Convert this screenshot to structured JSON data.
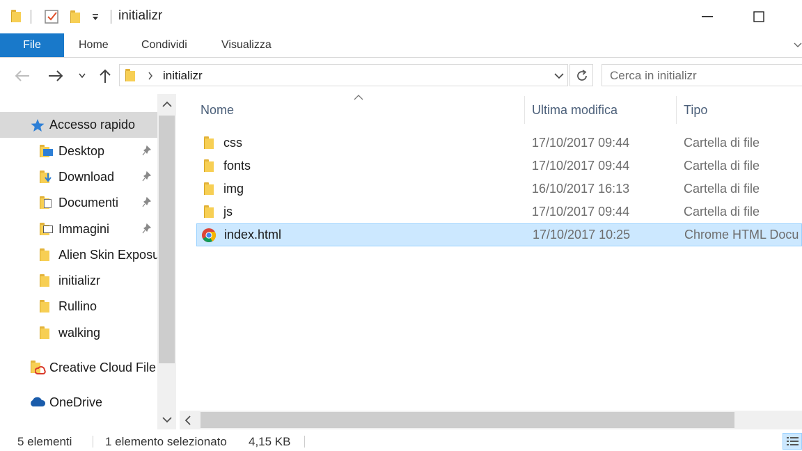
{
  "window": {
    "title": "initializr"
  },
  "ribbon": {
    "tabs": [
      "File",
      "Home",
      "Condividi",
      "Visualizza"
    ]
  },
  "address": {
    "path_item": "initializr",
    "search_placeholder": "Cerca in initializr"
  },
  "nav": {
    "quick_access": "Accesso rapido",
    "items": [
      {
        "label": "Desktop",
        "icon": "desktop-folder-icon",
        "pinned": true
      },
      {
        "label": "Download",
        "icon": "download-folder-icon",
        "pinned": true
      },
      {
        "label": "Documenti",
        "icon": "documents-folder-icon",
        "pinned": true
      },
      {
        "label": "Immagini",
        "icon": "pictures-folder-icon",
        "pinned": true
      },
      {
        "label": "Alien Skin Exposu",
        "icon": "folder-icon",
        "pinned": false
      },
      {
        "label": "initializr",
        "icon": "folder-icon",
        "pinned": false
      },
      {
        "label": "Rullino",
        "icon": "folder-icon",
        "pinned": false
      },
      {
        "label": "walking",
        "icon": "folder-icon",
        "pinned": false
      }
    ],
    "creative_cloud": "Creative Cloud File",
    "onedrive": "OneDrive"
  },
  "columns": {
    "name": "Nome",
    "modified": "Ultima modifica",
    "type": "Tipo"
  },
  "files": [
    {
      "name": "css",
      "modified": "17/10/2017 09:44",
      "type": "Cartella di file",
      "icon": "folder-icon",
      "selected": false
    },
    {
      "name": "fonts",
      "modified": "17/10/2017 09:44",
      "type": "Cartella di file",
      "icon": "folder-icon",
      "selected": false
    },
    {
      "name": "img",
      "modified": "16/10/2017 16:13",
      "type": "Cartella di file",
      "icon": "folder-icon",
      "selected": false
    },
    {
      "name": "js",
      "modified": "17/10/2017 09:44",
      "type": "Cartella di file",
      "icon": "folder-icon",
      "selected": false
    },
    {
      "name": "index.html",
      "modified": "17/10/2017 10:25",
      "type": "Chrome HTML Docu",
      "icon": "chrome-icon",
      "selected": true
    }
  ],
  "status": {
    "count": "5 elementi",
    "selection": "1 elemento selezionato",
    "size": "4,15 KB"
  },
  "colors": {
    "accent": "#1979ca",
    "selection_bg": "#cce8ff",
    "selection_border": "#99d1ff",
    "folder": "#f7cf54"
  }
}
